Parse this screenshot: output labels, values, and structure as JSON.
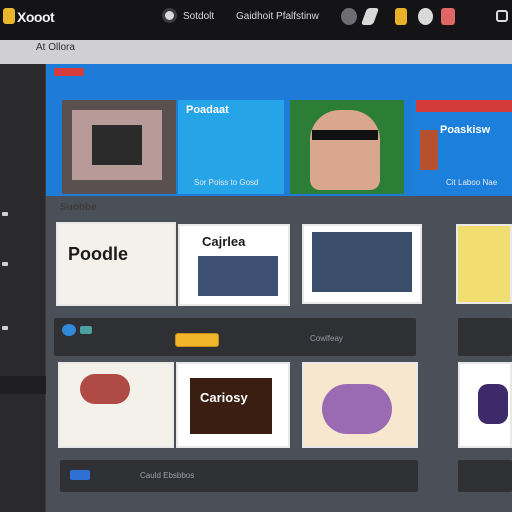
{
  "app": {
    "logo_text": "Xooot",
    "breadcrumb": "At Ollora"
  },
  "topbar": {
    "links": [
      "Sotdolt",
      "Gaidhoit Pfalfstinw"
    ],
    "icons": [
      "face-icon",
      "gamepad-icon",
      "flag-icon",
      "controller-icon",
      "cup-icon",
      "window-icon"
    ]
  },
  "hero": {
    "captions": [
      "Sor Poiss to Gosd",
      "Cit Laboo Nae"
    ],
    "tile_titles": [
      "Poadaat",
      "Poaskisw"
    ]
  },
  "section": {
    "label": "Suobbe"
  },
  "cards_row1": [
    {
      "title": "Poodle"
    },
    {
      "title": "Cajrlea"
    },
    {
      "title": ""
    },
    {
      "title": ""
    }
  ],
  "row2": {
    "button_label": "",
    "right_text": "Cowlfeay"
  },
  "cards_row2": [
    {
      "title": ""
    },
    {
      "title": "Cariosy"
    },
    {
      "title": ""
    },
    {
      "title": ""
    }
  ],
  "bottom": {
    "label": "Cauld Ebsbbos"
  },
  "colors": {
    "topbar": "#141416",
    "hero_blue": "#1f7bd8",
    "panel": "#2f3034",
    "accent_yellow": "#f0b52a"
  }
}
